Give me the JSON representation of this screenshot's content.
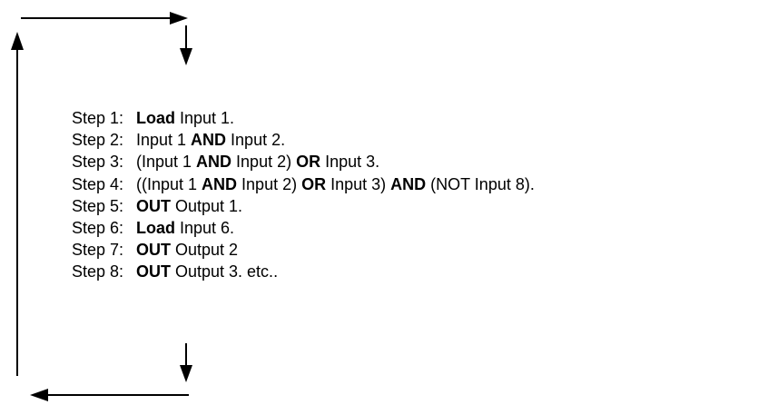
{
  "steps": [
    {
      "label": "Step 1:",
      "parts": [
        {
          "text": "Load",
          "bold": true
        },
        {
          "text": " Input 1.",
          "bold": false
        }
      ]
    },
    {
      "label": "Step 2:",
      "parts": [
        {
          "text": "Input 1 ",
          "bold": false
        },
        {
          "text": "AND",
          "bold": true
        },
        {
          "text": " Input 2.",
          "bold": false
        }
      ]
    },
    {
      "label": "Step 3:",
      "parts": [
        {
          "text": "(Input 1 ",
          "bold": false
        },
        {
          "text": "AND",
          "bold": true
        },
        {
          "text": " Input 2) ",
          "bold": false
        },
        {
          "text": "OR",
          "bold": true
        },
        {
          "text": " Input 3.",
          "bold": false
        }
      ]
    },
    {
      "label": "Step 4:",
      "parts": [
        {
          "text": "((Input 1 ",
          "bold": false
        },
        {
          "text": "AND",
          "bold": true
        },
        {
          "text": " Input 2) ",
          "bold": false
        },
        {
          "text": "OR",
          "bold": true
        },
        {
          "text": " Input 3) ",
          "bold": false
        },
        {
          "text": "AND",
          "bold": true
        },
        {
          "text": " (NOT Input 8).",
          "bold": false
        }
      ]
    },
    {
      "label": "Step 5:",
      "parts": [
        {
          "text": "OUT",
          "bold": true
        },
        {
          "text": " Output 1.",
          "bold": false
        }
      ]
    },
    {
      "label": "Step 6:",
      "parts": [
        {
          "text": "Load",
          "bold": true
        },
        {
          "text": " Input 6.",
          "bold": false
        }
      ]
    },
    {
      "label": "Step 7:",
      "parts": [
        {
          "text": "OUT",
          "bold": true
        },
        {
          "text": " Output 2",
          "bold": false
        }
      ]
    },
    {
      "label": "Step 8:",
      "parts": [
        {
          "text": "OUT",
          "bold": true
        },
        {
          "text": " Output 3. etc..",
          "bold": false
        }
      ]
    }
  ],
  "colors": {
    "line": "#000000",
    "text": "#000000",
    "background": "#ffffff"
  }
}
